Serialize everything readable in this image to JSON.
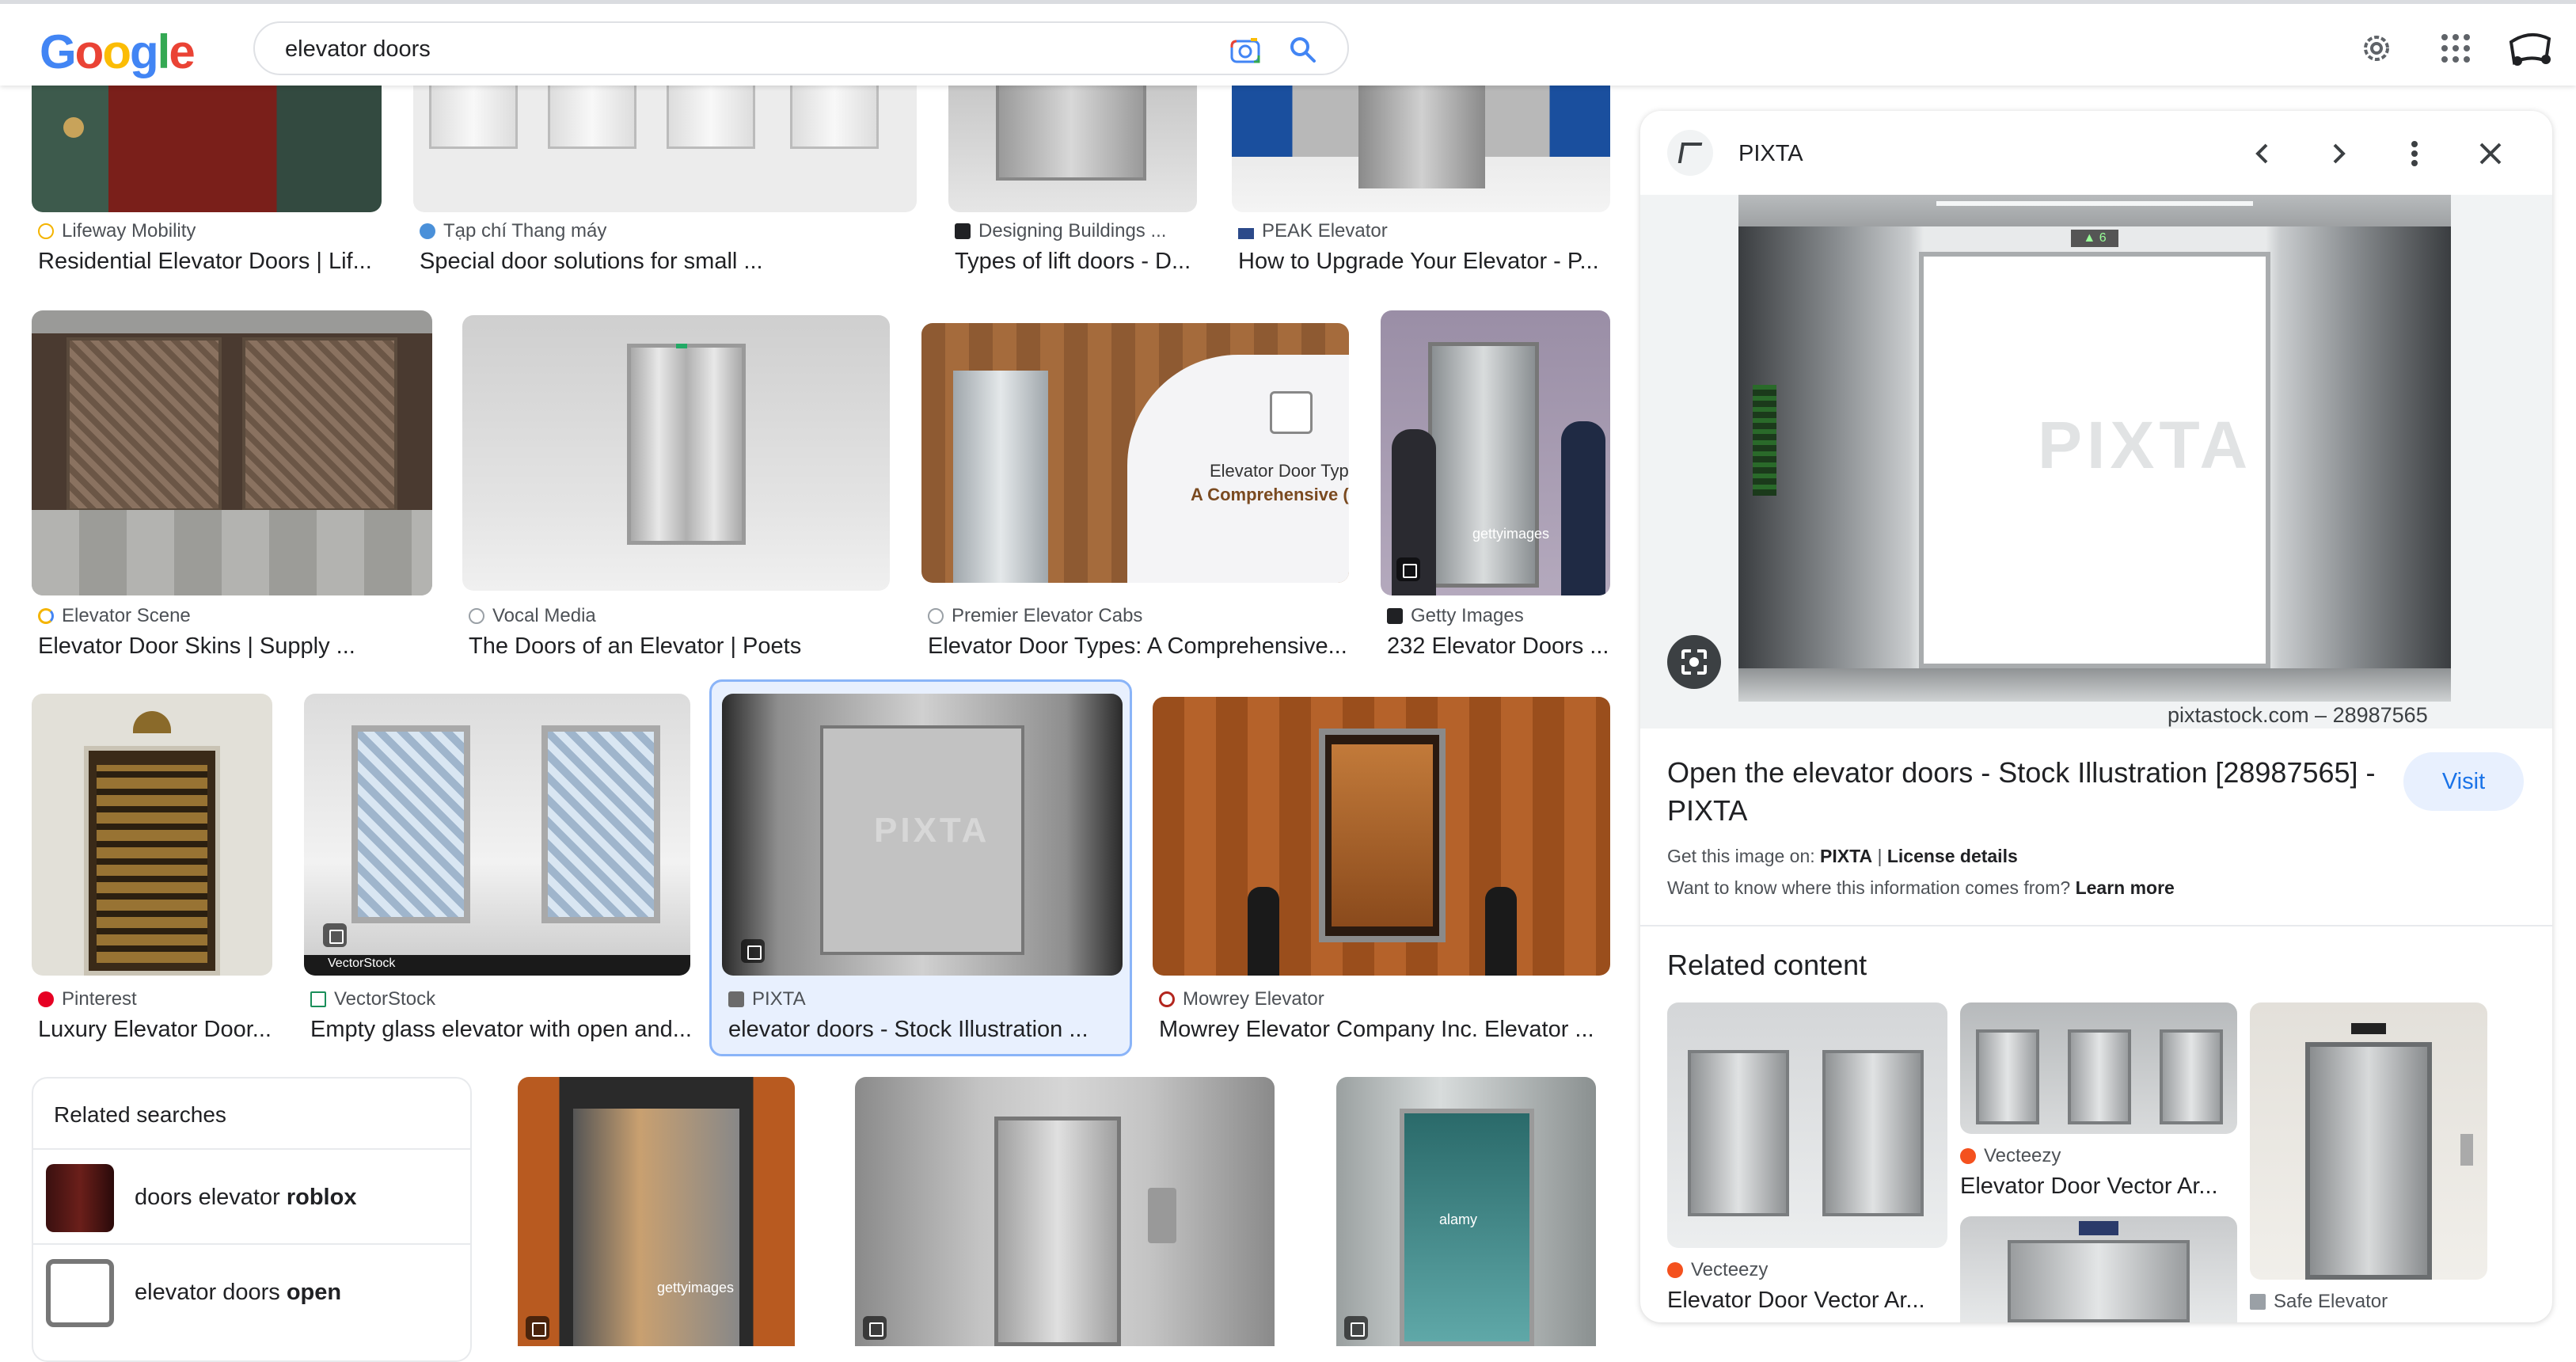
{
  "header": {
    "logo": "Google",
    "search_value": "elevator doors"
  },
  "row1": [
    {
      "source": "Lifeway Mobility",
      "title": "Residential Elevator Doors | Lif..."
    },
    {
      "source": "Tạp chí Thang máy",
      "title": "Special door solutions for small ..."
    },
    {
      "source": "Designing Buildings ...",
      "title": "Types of lift doors - D..."
    },
    {
      "source": "PEAK Elevator",
      "title": "How to Upgrade Your Elevator - P..."
    }
  ],
  "row2": [
    {
      "source": "Elevator Scene",
      "title": "Elevator Door Skins | Supply ..."
    },
    {
      "source": "Vocal Media",
      "title": "The Doors of an Elevator | Poets"
    },
    {
      "source": "Premier Elevator Cabs",
      "title": "Elevator Door Types: A Comprehensive..."
    },
    {
      "source": "Getty Images",
      "title": "232 Elevator Doors ..."
    }
  ],
  "row2_overlay": {
    "line1": "Elevator Door Typ",
    "line2": "A Comprehensive (",
    "watermark": "gettyimages"
  },
  "row3": [
    {
      "source": "Pinterest",
      "title": "Luxury Elevator Door..."
    },
    {
      "source": "VectorStock",
      "title": "Empty glass elevator with open and..."
    },
    {
      "source": "PIXTA",
      "title": "elevator doors - Stock Illustration ..."
    },
    {
      "source": "Mowrey Elevator",
      "title": "Mowrey Elevator Company Inc. Elevator ..."
    }
  ],
  "row3_overlay": {
    "vectorstock": "VectorStock",
    "pixta": "PIXTA"
  },
  "row4_overlay": {
    "getty": "gettyimages",
    "alamy": "alamy"
  },
  "related_searches": {
    "heading": "Related searches",
    "items": [
      {
        "prefix": "doors elevator ",
        "bold": "roblox"
      },
      {
        "prefix": "elevator doors ",
        "bold": "open"
      }
    ]
  },
  "panel": {
    "source": "PIXTA",
    "image_credit": "pixtastock.com – 28987565",
    "watermark": "PIXTA",
    "floor_display": "▲ 6",
    "title": "Open the elevator doors - Stock Illustration [28987565] - PIXTA",
    "visit_label": "Visit",
    "get_image_prefix": "Get this image on: ",
    "get_image_source": "PIXTA",
    "separator": " | ",
    "license_label": "License details",
    "info_question": "Want to know where this information comes from? ",
    "learn_more": "Learn more",
    "related_heading": "Related content",
    "related": [
      {
        "source": "Vecteezy",
        "title": "Elevator Door Vector Ar..."
      },
      {
        "source": "Vecteezy",
        "title": "Elevator Door Vector Ar..."
      },
      {
        "source": "Safe Elevator",
        "title": ""
      }
    ]
  },
  "colors": {
    "google_blue": "#4285F4",
    "google_red": "#EA4335",
    "google_yellow": "#FBBC05",
    "google_green": "#34A853",
    "visit_bg": "#e8f0fe",
    "visit_text": "#1a73e8",
    "selected_border": "#8ab4f8"
  }
}
